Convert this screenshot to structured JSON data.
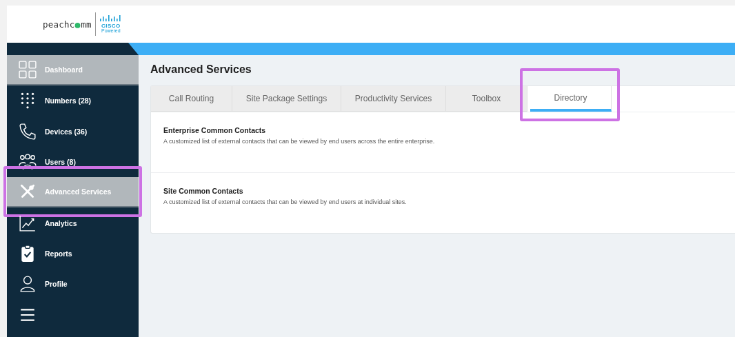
{
  "logo": {
    "before": "peachc",
    "after": "mm",
    "partner": "CISCO",
    "partner_note": "Powered"
  },
  "sidebar": {
    "items": [
      {
        "label": "Dashboard",
        "selected": true,
        "highlighted": false
      },
      {
        "label": "Numbers (28)",
        "selected": false,
        "highlighted": false
      },
      {
        "label": "Devices (36)",
        "selected": false,
        "highlighted": false
      },
      {
        "label": "Users (8)",
        "selected": false,
        "highlighted": false
      },
      {
        "label": "Advanced Services",
        "selected": true,
        "highlighted": true
      },
      {
        "label": "Analytics",
        "selected": false,
        "highlighted": false
      },
      {
        "label": "Reports",
        "selected": false,
        "highlighted": false
      },
      {
        "label": "Profile",
        "selected": false,
        "highlighted": false
      }
    ]
  },
  "page_title": "Advanced Services",
  "tabs": [
    {
      "label": "Call Routing",
      "selected": false,
      "highlighted": false
    },
    {
      "label": "Site Package Settings",
      "selected": false,
      "highlighted": false
    },
    {
      "label": "Productivity Services",
      "selected": false,
      "highlighted": false
    },
    {
      "label": "Toolbox",
      "selected": false,
      "highlighted": false
    },
    {
      "label": "Directory",
      "selected": true,
      "highlighted": true
    }
  ],
  "sections": [
    {
      "title": "Enterprise Common Contacts",
      "description": "A customized list of external contacts that can be viewed by end users across the entire enterprise."
    },
    {
      "title": "Site Common Contacts",
      "description": "A customized list of external contacts that can be viewed by end users at individual sites."
    }
  ]
}
